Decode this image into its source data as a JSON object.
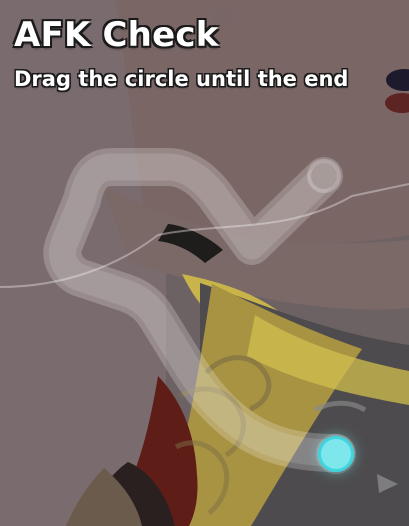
{
  "afk_check": {
    "title": "AFK Check",
    "instruction": "Drag the circle until the end"
  },
  "colors": {
    "background": "#6f6464",
    "path": "#ffffff",
    "drag_circle": "#7ee7ec",
    "drag_circle_ring": "#3fd5de",
    "text_outline": "#1a1a1a"
  },
  "icons": {
    "start": "drag-circle-icon",
    "end": "path-end-ring-icon"
  }
}
